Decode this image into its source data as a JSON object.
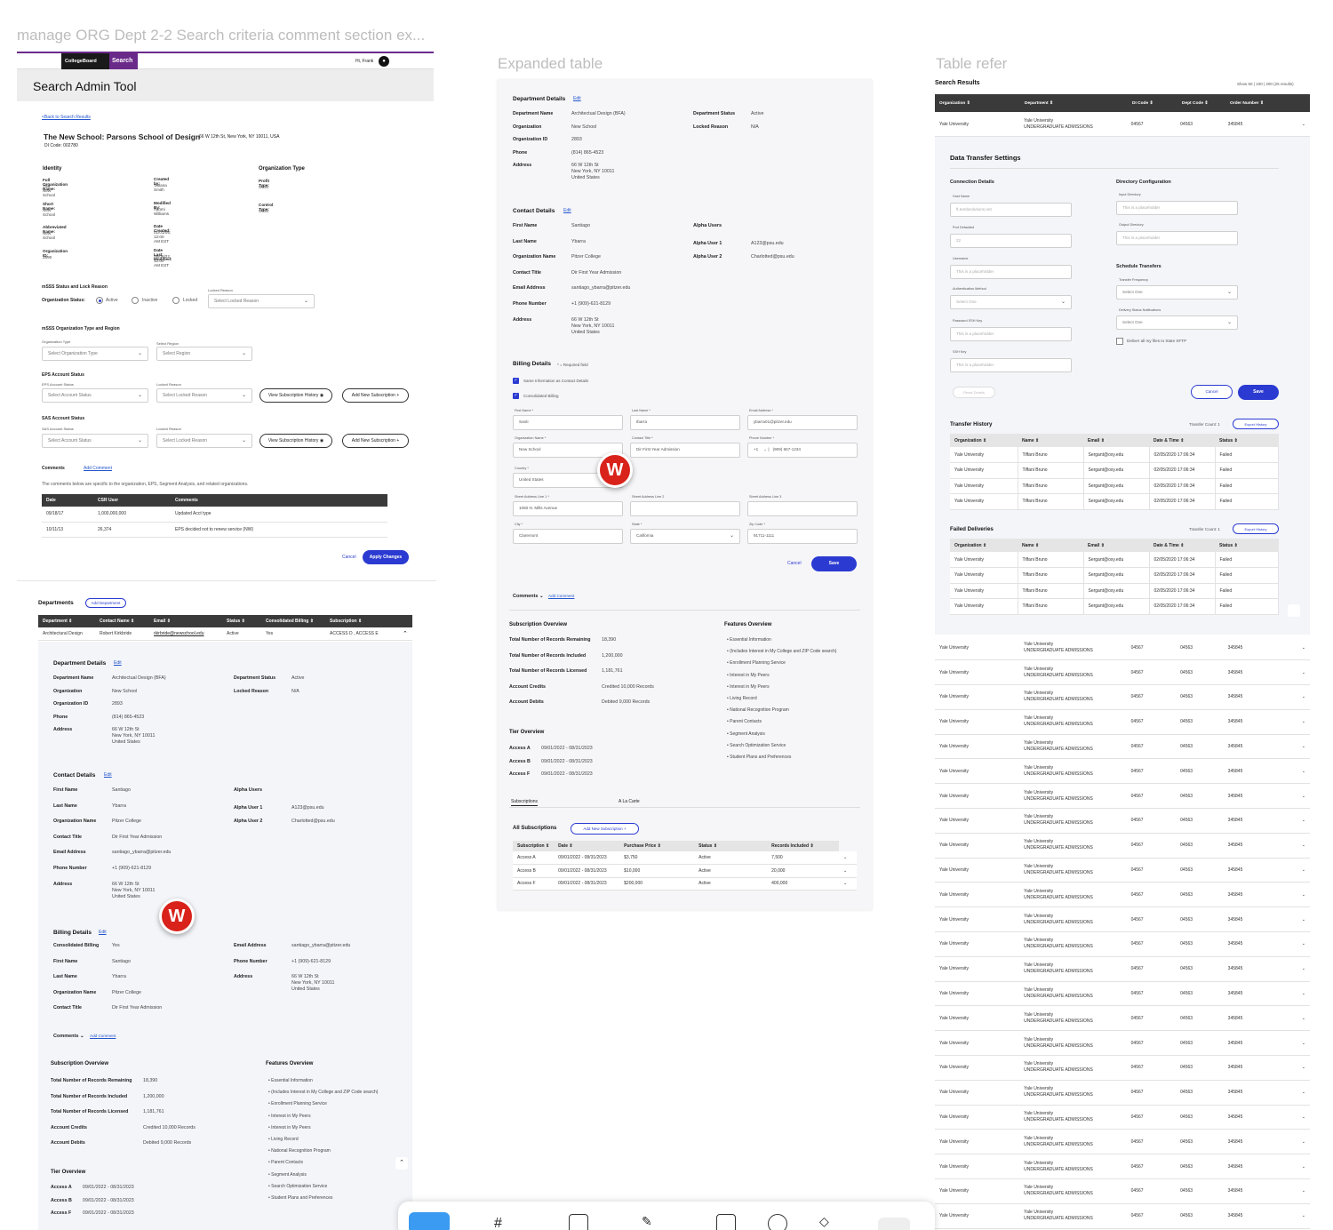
{
  "frames": {
    "left_title": "manage ORG Dept 2-2 Search criteria comment section ex...",
    "middle_title": "Expanded table",
    "right_title": "Table refer"
  },
  "header": {
    "logo": "CollegeBoard",
    "search_tab": "Search",
    "user_greeting": "Hi, Frank",
    "app_title": "Search Admin Tool"
  },
  "left": {
    "back_link": "<Back to Search Results",
    "school_title": "The New School: Parsons School of Design",
    "school_address": "66 W 12th St, New York, NY 10011, USA",
    "di_code": "DI Code: 002780",
    "identity_heading": "Identity",
    "org_type_heading": "Organization Type",
    "identity_fields": [
      {
        "label": "Full Organization Name:",
        "value": "The New School"
      },
      {
        "label": "Short Name:",
        "value": "New School"
      },
      {
        "label": "Abbreviated Name:",
        "value": "New School"
      },
      {
        "label": "Organization ID:",
        "value": "2890"
      }
    ],
    "identity_meta": [
      {
        "label": "Created by:",
        "value": "Tatiana Smith"
      },
      {
        "label": "Modified By:",
        "value": "Ayumi Williams"
      },
      {
        "label": "Date Created:",
        "value": "01/01/05, 12:00 AM EST"
      },
      {
        "label": "Date Last Modified:",
        "value": "06/06/22, 12:00 AM EST"
      }
    ],
    "org_type_fields": [
      {
        "label": "Profit Type:",
        "value": "Other"
      },
      {
        "label": "Control Type:",
        "value": "Other"
      }
    ],
    "mss_status_heading": "mSSS Status and Lock Reason",
    "org_status_label": "Organization Status:",
    "radio_active": "Active",
    "radio_inactive": "Inactive",
    "radio_locked": "Locked",
    "locked_reason_label": "Locked Reason",
    "locked_reason_placeholder": "Select Locked Reason",
    "mss_type_heading": "mSSS Organization Type and Region",
    "org_type_label": "Organization Type",
    "org_type_placeholder": "Select Organization Type",
    "region_label": "Select Region",
    "region_placeholder": "Select Region",
    "eps_heading": "EPS Account Status",
    "eps_status_label": "EPS Account Status",
    "account_status_placeholder": "Select Account Status",
    "sas_heading": "SAS Account Status",
    "sas_status_label": "SAS Account Status",
    "view_sub_history": "View Subscription History",
    "add_new_sub": "Add New Subscription",
    "comments_label": "Comments",
    "add_comment": "Add Comment",
    "comments_note": "The comments below are specific to the organization, EPS, Segment Analysis, and related organizations.",
    "comment_cols": [
      "Date",
      "CSR User",
      "Comments"
    ],
    "comment_rows": [
      [
        "09/18/17",
        "1,000,000,000",
        "Updated Acct type"
      ],
      [
        "10/11/13",
        "26,374",
        "EPS decided not to renew service (NW)"
      ]
    ],
    "cancel": "Cancel",
    "apply": "Apply Changes"
  },
  "departments": {
    "heading": "Departments",
    "add_department": "Add Department",
    "cols": [
      "Department",
      "Contact Name",
      "Email",
      "Status",
      "Consolidated Billing",
      "Subscription"
    ],
    "row": [
      "Architectural Design",
      "Robert Kirkbride",
      "rkirbride@newschool.edu",
      "Active",
      "Yes",
      "ACCESS D , ACCESS E"
    ]
  },
  "details": {
    "dept_heading": "Department Details",
    "edit": "Edit",
    "dept_fields": [
      {
        "k": "Department Name",
        "v": "Architectual Design (BFA)"
      },
      {
        "k": "Organization",
        "v": "New School"
      },
      {
        "k": "Organization ID",
        "v": "2893"
      },
      {
        "k": "Phone",
        "v": "(814) 865-4523"
      },
      {
        "k": "Address",
        "v": "66 W 12th St\nNew York, NY 10011\nUnited States"
      }
    ],
    "dept_status_fields": [
      {
        "k": "Department Status",
        "v": "Active"
      },
      {
        "k": "Locked Reason",
        "v": "N/A"
      }
    ],
    "contact_heading": "Contact Details",
    "contact_fields": [
      {
        "k": "First Name",
        "v": "Santiago"
      },
      {
        "k": "Last Name",
        "v": "Ybarra"
      },
      {
        "k": "Organization Name",
        "v": "Pitzer College"
      },
      {
        "k": "Contact Title",
        "v": "Dir First Year Admission"
      },
      {
        "k": "Email Address",
        "v": "santiago_ybarra@pitzer.edu"
      },
      {
        "k": "Phone Number",
        "v": "+1 (909)-621-8129"
      },
      {
        "k": "Address",
        "v": "66 W 12th St\nNew York, NY 10011\nUnited States"
      }
    ],
    "alpha_heading": "Alpha Users",
    "alpha_fields": [
      {
        "k": "Alpha User 1",
        "v": "A123@psu.edu"
      },
      {
        "k": "Alpha User 2",
        "v": "Charlotted@psu.edu"
      }
    ],
    "billing_heading": "Billing Details",
    "billing_fields": [
      {
        "k": "Consolidated Billing",
        "v": "Yes"
      },
      {
        "k": "First Name",
        "v": "Santiago"
      },
      {
        "k": "Last Name",
        "v": "Ybarra"
      },
      {
        "k": "Organization Name",
        "v": "Pitzer College"
      },
      {
        "k": "Contact Title",
        "v": "Dir First Year Admission"
      }
    ],
    "billing_right": [
      {
        "k": "Email Address",
        "v": "santiago_ybarra@pitzer.edu"
      },
      {
        "k": "Phone Number",
        "v": "+1 (909)-621-8129"
      },
      {
        "k": "Address",
        "v": "66 W 12th St\nNew York, NY 10011\nUnited States"
      }
    ],
    "comments": "Comments",
    "add_comment": "Add Comment",
    "sub_overview": "Subscription Overview",
    "sub_fields": [
      {
        "k": "Total Number of Records Remaining",
        "v": "18,390"
      },
      {
        "k": "Total Number of Records Included",
        "v": "1,200,000"
      },
      {
        "k": "Total Number of Records Licensed",
        "v": "1,181,761"
      },
      {
        "k": "Account Credits",
        "v": "Credited 10,000 Records"
      },
      {
        "k": "Account Debits",
        "v": "Debited 9,000 Records"
      }
    ],
    "features_overview": "Features Overview",
    "features": [
      "Essential Information",
      "(Includes Interest in My College and ZIP Code search)",
      "Enrollment Planning Service",
      "Interest in My Peers",
      "Interest in My Peers",
      "Living Record",
      "National Recognition Program",
      "Parent Contacts",
      "Segment Analysis",
      "Search Optimization Service",
      "Student Plans and Preferences"
    ],
    "tier_overview": "Tier Overview",
    "tiers": [
      {
        "k": "Access A",
        "v": "09/01/2022 - 08/31/2023"
      },
      {
        "k": "Access B",
        "v": "09/01/2022 - 08/31/2023"
      },
      {
        "k": "Access F",
        "v": "09/01/2022 - 08/31/2023"
      }
    ]
  },
  "expanded": {
    "billing_required": "* = Required field",
    "same_info": "Same Information as Contact Details",
    "consolidated": "Consolidated Billing",
    "form_labels": [
      "First Name *",
      "Last Name *",
      "Email Address *",
      "Organization Name *",
      "Contact Title *",
      "Phone Number *",
      "Country *",
      "Street Address Line 1 *",
      "Street Address Line 2",
      "Street Address Line 3",
      "City *",
      "State *",
      "Zip Code *"
    ],
    "form_values": [
      "Santi",
      "Ibarra",
      "ybarra01@pitzer.edu",
      "New School",
      "Dir First Year Admission",
      "+1",
      "(909) 657-1234",
      "United States",
      "1050 N. Mills Avenue",
      "",
      "",
      "Claremont",
      "California",
      "91711-1111"
    ],
    "cancel": "Cancel",
    "save": "Save",
    "subscriptions_tab": "Subscriptions",
    "a_la_carte": "A La Carte",
    "all_subscriptions": "All Subscriptions",
    "add_new_subscription": "Add New Subscription",
    "sub_cols": [
      "Subscription",
      "Date",
      "Purchase Price",
      "Status",
      "Records Included"
    ],
    "sub_rows": [
      [
        "Access A",
        "09/01/2022 - 08/31/2023",
        "$3,750",
        "Active",
        "7,500"
      ],
      [
        "Access B",
        "09/01/2022 - 08/31/2023",
        "$10,000",
        "Active",
        "20,000"
      ],
      [
        "Access F",
        "09/01/2022 - 08/31/2023",
        "$200,000",
        "Active",
        "400,000"
      ]
    ]
  },
  "table_refer": {
    "search_results": "Search Results",
    "show": "Show",
    "show_options": "50 | 100 | 200 (25 results)",
    "cols": [
      "Organization",
      "Department",
      "DI Code",
      "Dept Code",
      "Order Number"
    ],
    "row_org": "Yale University",
    "row_dept_1": "Yale University",
    "row_dept_2": "UNDERGRADUATE ADMISSIONS",
    "row_di": "04567",
    "row_dept_code": "04563",
    "row_order": "345845",
    "dts_title": "Data Transfer Settings",
    "connection_details": "Connection Details",
    "host_name": "Host Name",
    "host_value": "ft.tembsolutions.net",
    "port_label": "Port Defaulted",
    "port_value": "22",
    "username_label": "Username",
    "placeholder": "This is a placeholder",
    "auth_label": "Authentication Method",
    "select_one": "Select One",
    "password_label": "Password SSH Key",
    "ssh_label": "SSH Key",
    "reset": "Reset Details",
    "directory_config": "Directory Configuration",
    "input_dir": "Input Directory",
    "output_dir": "Output Directory",
    "schedule": "Schedule Transfers",
    "freq": "Transfer Frequency",
    "notif": "Delivery Status Notifications",
    "deliver_all": "Deliver all my files to State SFTP",
    "cancel": "Cancel",
    "save": "Save",
    "history": "Transfer History",
    "transfer_count": "Transfer Count: 1",
    "export": "Export History",
    "failed": "Failed Deliveries",
    "hist_cols": [
      "Organization",
      "Name",
      "Email",
      "Date & Time",
      "Status"
    ],
    "hist_row": [
      "Yale University",
      "Tiffani Bruno",
      "Sergant@oxy.edu",
      "02/05/2020 17:06:34",
      "Failed"
    ]
  },
  "badge": {
    "letter": "W"
  }
}
